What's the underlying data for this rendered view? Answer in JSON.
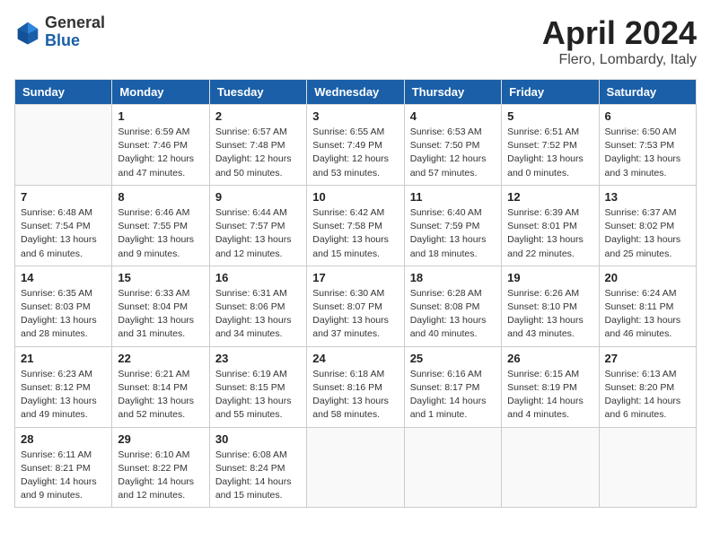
{
  "header": {
    "logo_general": "General",
    "logo_blue": "Blue",
    "title": "April 2024",
    "subtitle": "Flero, Lombardy, Italy"
  },
  "calendar": {
    "days_of_week": [
      "Sunday",
      "Monday",
      "Tuesday",
      "Wednesday",
      "Thursday",
      "Friday",
      "Saturday"
    ],
    "weeks": [
      [
        {
          "day": "",
          "empty": true
        },
        {
          "day": "1",
          "sunrise": "Sunrise: 6:59 AM",
          "sunset": "Sunset: 7:46 PM",
          "daylight": "Daylight: 12 hours and 47 minutes."
        },
        {
          "day": "2",
          "sunrise": "Sunrise: 6:57 AM",
          "sunset": "Sunset: 7:48 PM",
          "daylight": "Daylight: 12 hours and 50 minutes."
        },
        {
          "day": "3",
          "sunrise": "Sunrise: 6:55 AM",
          "sunset": "Sunset: 7:49 PM",
          "daylight": "Daylight: 12 hours and 53 minutes."
        },
        {
          "day": "4",
          "sunrise": "Sunrise: 6:53 AM",
          "sunset": "Sunset: 7:50 PM",
          "daylight": "Daylight: 12 hours and 57 minutes."
        },
        {
          "day": "5",
          "sunrise": "Sunrise: 6:51 AM",
          "sunset": "Sunset: 7:52 PM",
          "daylight": "Daylight: 13 hours and 0 minutes."
        },
        {
          "day": "6",
          "sunrise": "Sunrise: 6:50 AM",
          "sunset": "Sunset: 7:53 PM",
          "daylight": "Daylight: 13 hours and 3 minutes."
        }
      ],
      [
        {
          "day": "7",
          "sunrise": "Sunrise: 6:48 AM",
          "sunset": "Sunset: 7:54 PM",
          "daylight": "Daylight: 13 hours and 6 minutes."
        },
        {
          "day": "8",
          "sunrise": "Sunrise: 6:46 AM",
          "sunset": "Sunset: 7:55 PM",
          "daylight": "Daylight: 13 hours and 9 minutes."
        },
        {
          "day": "9",
          "sunrise": "Sunrise: 6:44 AM",
          "sunset": "Sunset: 7:57 PM",
          "daylight": "Daylight: 13 hours and 12 minutes."
        },
        {
          "day": "10",
          "sunrise": "Sunrise: 6:42 AM",
          "sunset": "Sunset: 7:58 PM",
          "daylight": "Daylight: 13 hours and 15 minutes."
        },
        {
          "day": "11",
          "sunrise": "Sunrise: 6:40 AM",
          "sunset": "Sunset: 7:59 PM",
          "daylight": "Daylight: 13 hours and 18 minutes."
        },
        {
          "day": "12",
          "sunrise": "Sunrise: 6:39 AM",
          "sunset": "Sunset: 8:01 PM",
          "daylight": "Daylight: 13 hours and 22 minutes."
        },
        {
          "day": "13",
          "sunrise": "Sunrise: 6:37 AM",
          "sunset": "Sunset: 8:02 PM",
          "daylight": "Daylight: 13 hours and 25 minutes."
        }
      ],
      [
        {
          "day": "14",
          "sunrise": "Sunrise: 6:35 AM",
          "sunset": "Sunset: 8:03 PM",
          "daylight": "Daylight: 13 hours and 28 minutes."
        },
        {
          "day": "15",
          "sunrise": "Sunrise: 6:33 AM",
          "sunset": "Sunset: 8:04 PM",
          "daylight": "Daylight: 13 hours and 31 minutes."
        },
        {
          "day": "16",
          "sunrise": "Sunrise: 6:31 AM",
          "sunset": "Sunset: 8:06 PM",
          "daylight": "Daylight: 13 hours and 34 minutes."
        },
        {
          "day": "17",
          "sunrise": "Sunrise: 6:30 AM",
          "sunset": "Sunset: 8:07 PM",
          "daylight": "Daylight: 13 hours and 37 minutes."
        },
        {
          "day": "18",
          "sunrise": "Sunrise: 6:28 AM",
          "sunset": "Sunset: 8:08 PM",
          "daylight": "Daylight: 13 hours and 40 minutes."
        },
        {
          "day": "19",
          "sunrise": "Sunrise: 6:26 AM",
          "sunset": "Sunset: 8:10 PM",
          "daylight": "Daylight: 13 hours and 43 minutes."
        },
        {
          "day": "20",
          "sunrise": "Sunrise: 6:24 AM",
          "sunset": "Sunset: 8:11 PM",
          "daylight": "Daylight: 13 hours and 46 minutes."
        }
      ],
      [
        {
          "day": "21",
          "sunrise": "Sunrise: 6:23 AM",
          "sunset": "Sunset: 8:12 PM",
          "daylight": "Daylight: 13 hours and 49 minutes."
        },
        {
          "day": "22",
          "sunrise": "Sunrise: 6:21 AM",
          "sunset": "Sunset: 8:14 PM",
          "daylight": "Daylight: 13 hours and 52 minutes."
        },
        {
          "day": "23",
          "sunrise": "Sunrise: 6:19 AM",
          "sunset": "Sunset: 8:15 PM",
          "daylight": "Daylight: 13 hours and 55 minutes."
        },
        {
          "day": "24",
          "sunrise": "Sunrise: 6:18 AM",
          "sunset": "Sunset: 8:16 PM",
          "daylight": "Daylight: 13 hours and 58 minutes."
        },
        {
          "day": "25",
          "sunrise": "Sunrise: 6:16 AM",
          "sunset": "Sunset: 8:17 PM",
          "daylight": "Daylight: 14 hours and 1 minute."
        },
        {
          "day": "26",
          "sunrise": "Sunrise: 6:15 AM",
          "sunset": "Sunset: 8:19 PM",
          "daylight": "Daylight: 14 hours and 4 minutes."
        },
        {
          "day": "27",
          "sunrise": "Sunrise: 6:13 AM",
          "sunset": "Sunset: 8:20 PM",
          "daylight": "Daylight: 14 hours and 6 minutes."
        }
      ],
      [
        {
          "day": "28",
          "sunrise": "Sunrise: 6:11 AM",
          "sunset": "Sunset: 8:21 PM",
          "daylight": "Daylight: 14 hours and 9 minutes."
        },
        {
          "day": "29",
          "sunrise": "Sunrise: 6:10 AM",
          "sunset": "Sunset: 8:22 PM",
          "daylight": "Daylight: 14 hours and 12 minutes."
        },
        {
          "day": "30",
          "sunrise": "Sunrise: 6:08 AM",
          "sunset": "Sunset: 8:24 PM",
          "daylight": "Daylight: 14 hours and 15 minutes."
        },
        {
          "day": "",
          "empty": true
        },
        {
          "day": "",
          "empty": true
        },
        {
          "day": "",
          "empty": true
        },
        {
          "day": "",
          "empty": true
        }
      ]
    ]
  }
}
